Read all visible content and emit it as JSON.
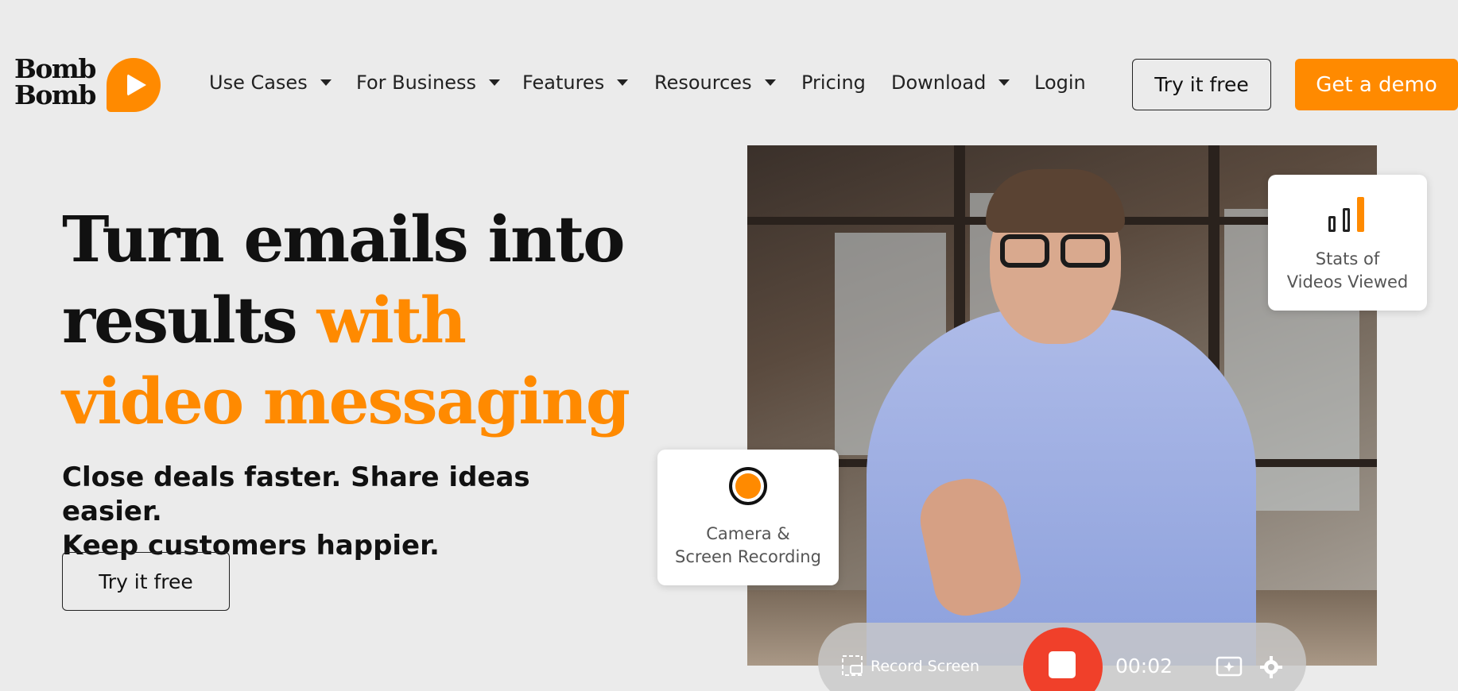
{
  "logo": {
    "line1": "Bomb",
    "line2": "Bomb"
  },
  "nav": {
    "items": [
      {
        "label": "Use Cases",
        "dropdown": true
      },
      {
        "label": "For Business",
        "dropdown": true
      },
      {
        "label": "Features",
        "dropdown": true
      },
      {
        "label": "Resources",
        "dropdown": true
      },
      {
        "label": "Pricing",
        "dropdown": false
      },
      {
        "label": "Download",
        "dropdown": true
      },
      {
        "label": "Login",
        "dropdown": false
      }
    ],
    "try_free": "Try it free",
    "get_demo": "Get a demo"
  },
  "hero": {
    "title_line1": "Turn emails into",
    "title_line2_a": "results ",
    "title_line2_b": "with",
    "title_line3": "video messaging",
    "subtitle_line1": "Close deals faster. Share ideas easier.",
    "subtitle_line2": "Keep customers happier.",
    "cta": "Try it free"
  },
  "video": {
    "stats_card": {
      "line1": "Stats of",
      "line2": "Videos Viewed"
    },
    "camera_card": {
      "line1": "Camera &",
      "line2": "Screen Recording"
    },
    "controls": {
      "record_screen": "Record Screen",
      "timer": "00:02"
    }
  },
  "colors": {
    "accent": "#ff8a00",
    "background": "#ebebeb",
    "record": "#f0402a"
  }
}
